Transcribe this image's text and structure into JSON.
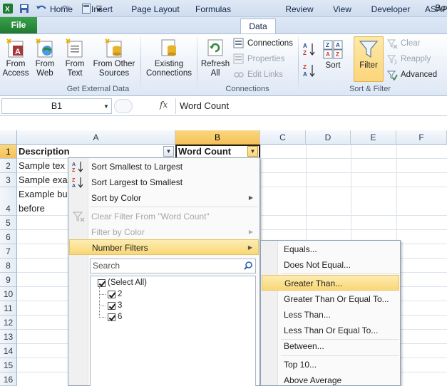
{
  "titlebar": {
    "title_fragment": "Bo"
  },
  "tabs": [
    {
      "label": "File"
    },
    {
      "label": "Home"
    },
    {
      "label": "Insert"
    },
    {
      "label": "Page Layout"
    },
    {
      "label": "Formulas"
    },
    {
      "label": "Data"
    },
    {
      "label": "Review"
    },
    {
      "label": "View"
    },
    {
      "label": "Developer"
    },
    {
      "label": "ASAP"
    }
  ],
  "ribbon": {
    "get_external": {
      "from_access": "From Access",
      "from_web": "From Web",
      "from_text": "From Text",
      "from_other": "From Other Sources",
      "existing": "Existing Connections",
      "label": "Get External Data"
    },
    "connections": {
      "refresh": "Refresh All",
      "connections": "Connections",
      "properties": "Properties",
      "edit_links": "Edit Links",
      "label": "Connections"
    },
    "sort_filter": {
      "sort": "Sort",
      "filter": "Filter",
      "clear": "Clear",
      "reapply": "Reapply",
      "advanced": "Advanced",
      "label": "Sort & Filter"
    }
  },
  "formula_bar": {
    "name_box": "B1",
    "fx": "fx",
    "content": "Word Count"
  },
  "columns": [
    "A",
    "B",
    "C",
    "D",
    "E",
    "F"
  ],
  "rows": [
    "1",
    "2",
    "3",
    "4",
    "5",
    "6",
    "7",
    "8",
    "9",
    "10",
    "11",
    "12",
    "13",
    "14",
    "15",
    "16"
  ],
  "cells": {
    "a1": "Description",
    "b1": "Word Count",
    "a2": "Sample tex",
    "a3": "Sample exa",
    "a4_line1": "Example bu",
    "a4_line2": "before"
  },
  "filter_menu": {
    "sort_asc": "Sort Smallest to Largest",
    "sort_desc": "Sort Largest to Smallest",
    "sort_color": "Sort by Color",
    "clear_filter": "Clear Filter From \"Word Count\"",
    "filter_color": "Filter by Color",
    "number_filters": "Number Filters",
    "search_placeholder": "Search",
    "values": [
      "(Select All)",
      "2",
      "3",
      "6"
    ]
  },
  "number_filters_submenu": [
    "Equals...",
    "Does Not Equal...",
    "Greater Than...",
    "Greater Than Or Equal To...",
    "Less Than...",
    "Less Than Or Equal To...",
    "Between...",
    "Top 10...",
    "Above Average"
  ],
  "icons": {
    "excel": "excel-logo-icon",
    "save": "save-icon",
    "undo": "undo-icon",
    "redo": "redo-icon",
    "customize": "customize-qat-icon",
    "filter": "funnel-icon",
    "search": "magnifier-icon"
  },
  "colors": {
    "file_tab": "#2a8a3c",
    "highlight": "#fad776",
    "selected_header": "#f5c15a",
    "filter_btn_active": "#fbd57a"
  }
}
